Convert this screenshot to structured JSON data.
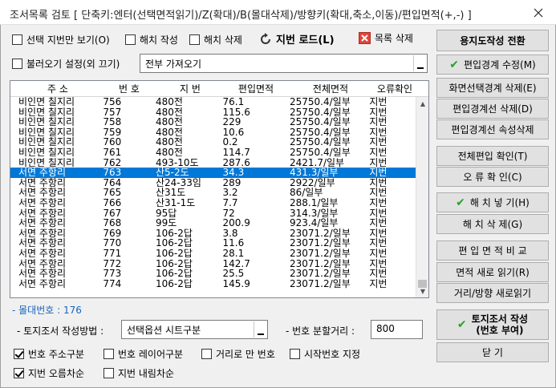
{
  "window": {
    "title": "조서목록 검토 [ 단축키:엔터(선택면적읽기)/Z(확대)/B(몰대삭제)/방향키(확대,축소,이동)/편입면적(+,-) ]"
  },
  "toolbar": {
    "selected_only": "선택 지번만 보기(O)",
    "hatch_create": "해치 작성",
    "hatch_delete": "해치 삭제",
    "jibun_load": "지번 로드(L)",
    "list_delete": "목록 삭제",
    "load_setting": "불러오기 설정(외 끄기)",
    "load_value": "전부 가져오기"
  },
  "grid": {
    "columns": [
      "주 소",
      "번 호",
      "지 번",
      "편입면적",
      "전체면적",
      "오류확인"
    ],
    "rows": [
      [
        "비인면 칠지리",
        "756",
        "480전",
        "76.1",
        "25750.4/일부",
        "지번"
      ],
      [
        "비인면 칠지리",
        "757",
        "480전",
        "115.6",
        "25750.4/일부",
        "지번"
      ],
      [
        "비인면 칠지리",
        "758",
        "480전",
        "229",
        "25750.4/일부",
        "지번"
      ],
      [
        "비인면 칠지리",
        "759",
        "480전",
        "10.6",
        "25750.4/일부",
        "지번"
      ],
      [
        "비인면 칠지리",
        "760",
        "480전",
        "0.2",
        "25750.4/일부",
        "지번"
      ],
      [
        "비인면 칠지리",
        "761",
        "480전",
        "114.7",
        "25750.4/일부",
        "지번"
      ],
      [
        "비인면 칠지리",
        "762",
        "493-10도",
        "287.6",
        "2421.7/일부",
        "지번"
      ],
      [
        "서면 주항리",
        "763",
        "산5-2도",
        "34.3",
        "431.3/일부",
        "지번"
      ],
      [
        "서면 주항리",
        "764",
        "산24-33임",
        "289",
        "2922/일부",
        "지번"
      ],
      [
        "서면 주항리",
        "765",
        "산31도",
        "3.2",
        "86/일부",
        "지번"
      ],
      [
        "서면 주항리",
        "766",
        "산31-1도",
        "7.7",
        "288.1/일부",
        "지번"
      ],
      [
        "서면 주항리",
        "767",
        "95답",
        "72",
        "314.3/일부",
        "지번"
      ],
      [
        "서면 주항리",
        "768",
        "99도",
        "200.9",
        "923.4/일부",
        "지번"
      ],
      [
        "서면 주항리",
        "769",
        "106-2답",
        "3.8",
        "23071.2/일부",
        "지번"
      ],
      [
        "서면 주항리",
        "770",
        "106-2답",
        "11.6",
        "23071.2/일부",
        "지번"
      ],
      [
        "서면 주항리",
        "771",
        "106-2답",
        "28.1",
        "23071.2/일부",
        "지번"
      ],
      [
        "서면 주항리",
        "772",
        "106-2답",
        "142.7",
        "23071.2/일부",
        "지번"
      ],
      [
        "서면 주항리",
        "773",
        "106-2답",
        "25.5",
        "23071.2/일부",
        "지번"
      ],
      [
        "서면 주항리",
        "774",
        "106-2답",
        "145.9",
        "23071.2/일부",
        "지번"
      ]
    ],
    "selected_index": 7
  },
  "status": {
    "count_text": "- 몰대번호 : 176"
  },
  "options": {
    "method_label": "- 토지조서 작성방법 :",
    "method_value": "선택옵션 시트구분",
    "interval_label": "- 번호 분할거리 :",
    "interval_value": "800",
    "chk_addr_group": "번호 주소구분",
    "chk_layer_group": "번호 레이어구분",
    "chk_distance_only": "거리로 만 번호",
    "chk_start_number": "시작번호 지정",
    "chk_asc": "지번 오름차순",
    "chk_desc": "지번 내림차순"
  },
  "side": {
    "map_convert": "용지도작성 전환",
    "edit_boundary": "편입경계 수정(M)",
    "delete_screen_boundary": "화면선택경계 삭제(E)",
    "delete_boundary_line": "편입경계선 삭제(D)",
    "delete_boundary_attr": "편입경계선 속성삭제",
    "check_all": "전체편입 확인(T)",
    "error_check": "오 류 확 인(C)",
    "hatch_insert": "해 치 넣 기(H)",
    "hatch_remove": "해 치 삭 제(G)",
    "area_compare": "편 입 면 적 비 교",
    "area_reload": "면적 새로 읽기(R)",
    "dist_reload": "거리/방향 새로읽기",
    "create_land": "토지조서 작성",
    "create_land_sub": "(번호 부여)",
    "close": "닫 기"
  },
  "colors": {
    "selection": "#0078d7",
    "check_icon": "#2aa02a",
    "delete_icon": "#e0463b"
  }
}
